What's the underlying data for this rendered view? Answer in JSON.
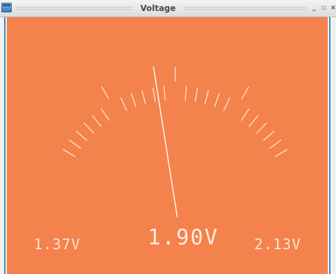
{
  "window": {
    "title": "Voltage",
    "minimize_glyph": "‗",
    "maximize_glyph": "▫",
    "close_glyph": "×"
  },
  "meter": {
    "min_label": "1.37V",
    "max_label": "2.13V",
    "value_label": "1.90V",
    "min_value": 1.37,
    "max_value": 2.13,
    "reading": 1.9,
    "needle_fraction": 0.43,
    "tick_count": 25,
    "major_tick_every": 6,
    "colors": {
      "background": "#f4824c",
      "ticks": "#fde8db",
      "needle": "#fff3ea",
      "text": "#fde3d3"
    }
  }
}
